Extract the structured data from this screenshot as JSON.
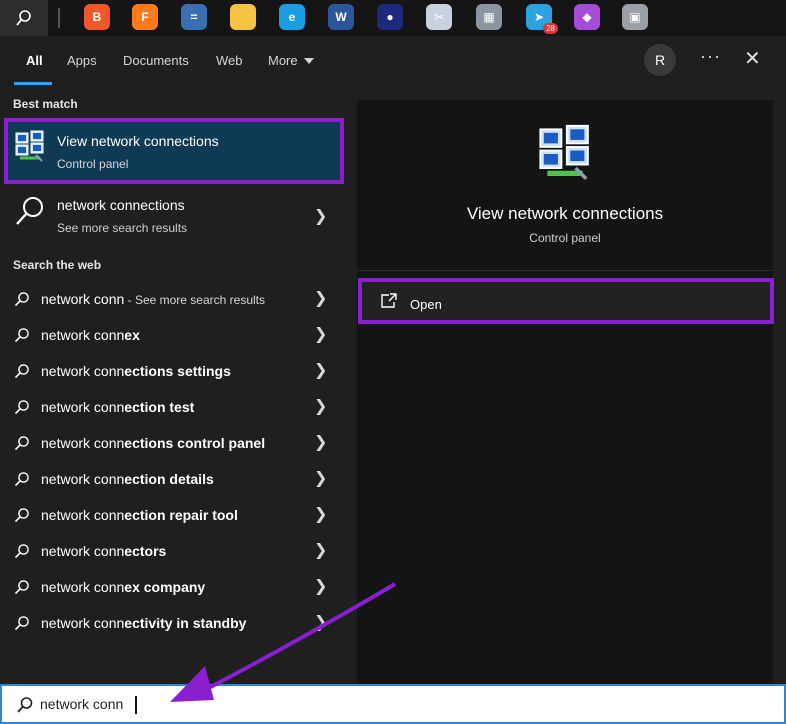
{
  "taskbar": {
    "apps": [
      {
        "name": "brave",
        "color": "#f1582c",
        "glyph": "B"
      },
      {
        "name": "firefox",
        "color": "#ff7a1a",
        "glyph": "F"
      },
      {
        "name": "calculator",
        "color": "#3a6fb3",
        "glyph": "="
      },
      {
        "name": "file-explorer",
        "color": "#f5c242",
        "glyph": ""
      },
      {
        "name": "edge",
        "color": "#1b9de2",
        "glyph": "e"
      },
      {
        "name": "word",
        "color": "#2b579a",
        "glyph": "W"
      },
      {
        "name": "app-7",
        "color": "#1b2a7a",
        "glyph": "●"
      },
      {
        "name": "app-8",
        "color": "#c9d3e0",
        "glyph": "✂"
      },
      {
        "name": "app-9",
        "color": "#8c96a3",
        "glyph": "▦"
      },
      {
        "name": "telegram",
        "color": "#2aa3df",
        "glyph": "➤",
        "badge": "28"
      },
      {
        "name": "app-11",
        "color": "#a44cd6",
        "glyph": "◆"
      },
      {
        "name": "app-12",
        "color": "#9aa0a8",
        "glyph": "▣"
      }
    ]
  },
  "tabs": {
    "all": "All",
    "apps": "Apps",
    "documents": "Documents",
    "web": "Web",
    "more": "More"
  },
  "header": {
    "avatar_letter": "R",
    "ellipsis": "···",
    "close": "✕"
  },
  "best_match": {
    "label": "Best match",
    "title": "View network connections",
    "subtitle": "Control panel"
  },
  "search_result": {
    "title": "network connections",
    "subtitle": "See more search results"
  },
  "web_section": {
    "label": "Search the web",
    "items": [
      {
        "prefix": "network conn",
        "bold": "",
        "hint": " - See more search results"
      },
      {
        "prefix": "network conn",
        "bold": "ex",
        "hint": ""
      },
      {
        "prefix": "network conn",
        "bold": "ections settings",
        "hint": ""
      },
      {
        "prefix": "network conn",
        "bold": "ection test",
        "hint": ""
      },
      {
        "prefix": "network conn",
        "bold": "ections control panel",
        "hint": ""
      },
      {
        "prefix": "network conn",
        "bold": "ection details",
        "hint": ""
      },
      {
        "prefix": "network conn",
        "bold": "ection repair tool",
        "hint": ""
      },
      {
        "prefix": "network conn",
        "bold": "ectors",
        "hint": ""
      },
      {
        "prefix": "network conn",
        "bold": "ex company",
        "hint": ""
      },
      {
        "prefix": "network conn",
        "bold": "ectivity in standby",
        "hint": ""
      }
    ]
  },
  "preview": {
    "title": "View network connections",
    "subtitle": "Control panel",
    "open_label": "Open"
  },
  "search": {
    "value": "network conn"
  },
  "colors": {
    "highlight_border": "#8a1fd1",
    "selection_bg": "#0e3a55",
    "accent": "#3c9be8",
    "arrow": "#8a1fd1"
  }
}
